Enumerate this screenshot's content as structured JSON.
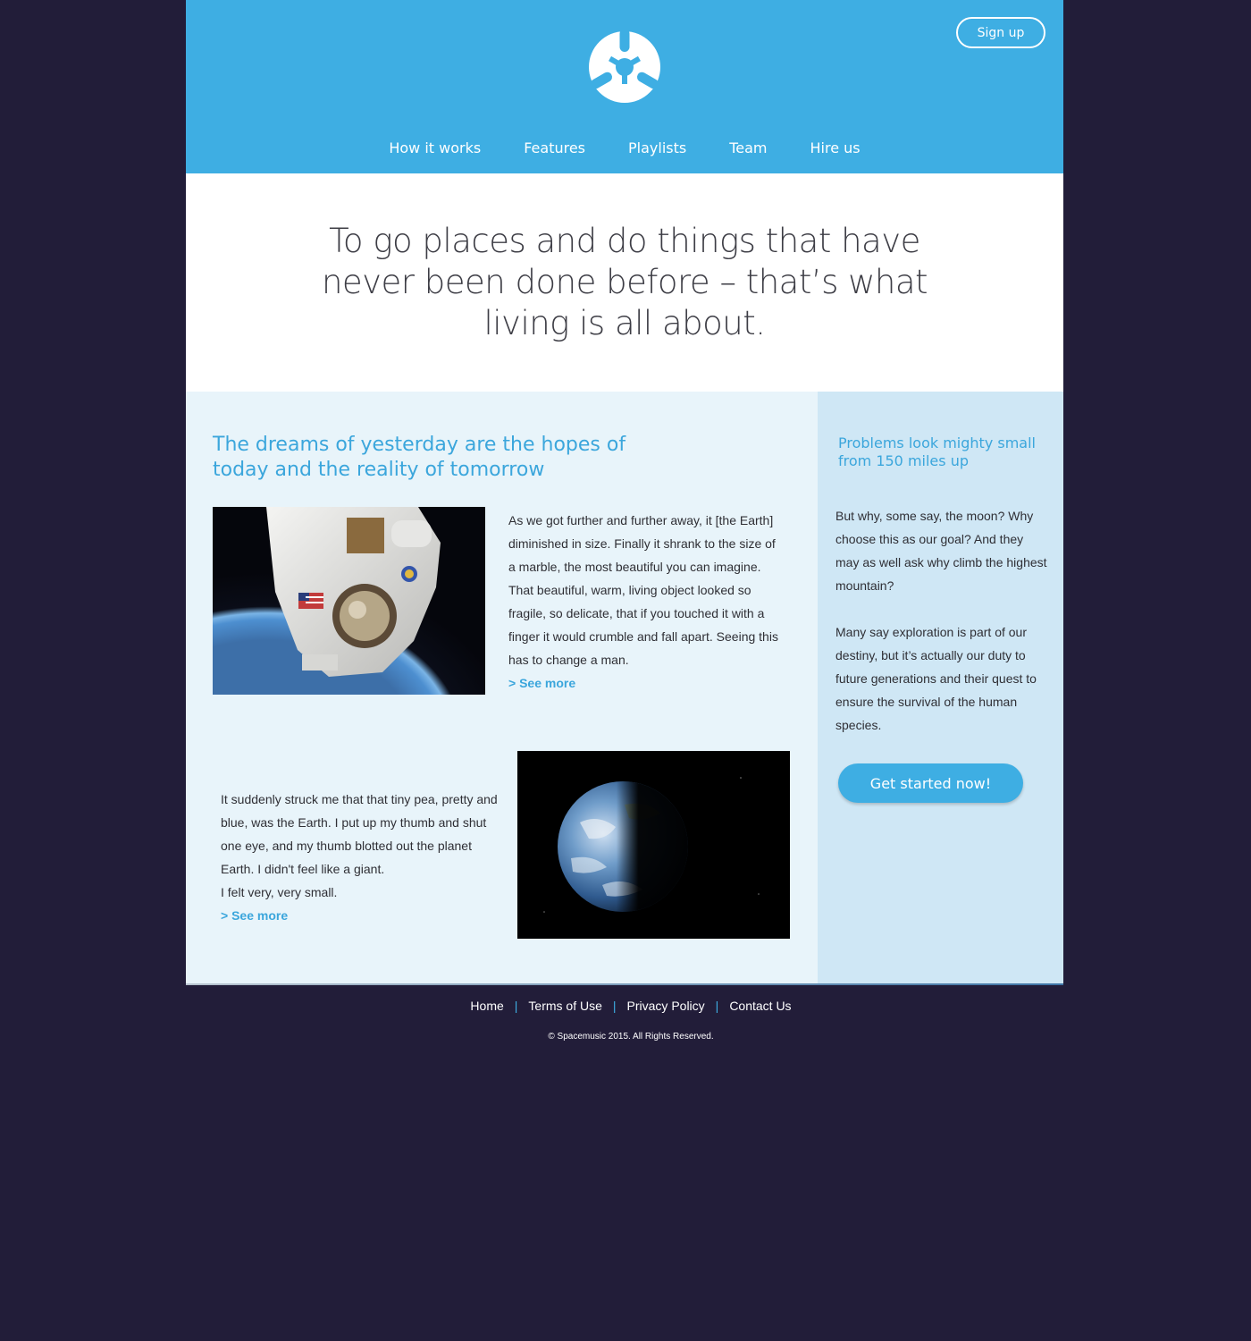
{
  "header": {
    "signup_label": "Sign up",
    "nav": [
      "How it works",
      "Features",
      "Playlists",
      "Team",
      "Hire us"
    ]
  },
  "quote": "To go places and do things that have never been done before – that’s what living is all about.",
  "main": {
    "heading": "The dreams of yesterday are the hopes of today and the reality of tomorrow",
    "article1": {
      "image_subject": "astronaut-photo",
      "text": "As we got further and further away, it [the Earth] diminished in size. Finally it shrank to the size of a marble, the most beautiful you can imagine. That beautiful, warm, living object looked so fragile, so delicate, that if you touched it with a finger it would crumble and fall apart. Seeing this has to change a man.",
      "see_more": "> See more"
    },
    "article2": {
      "image_subject": "earth-photo",
      "text": "It suddenly struck me that that tiny pea, pretty and blue, was the Earth. I put up my thumb and shut one eye, and my thumb blotted out the planet Earth. I didn't feel like a giant.",
      "text_line2": "I felt very, very small.",
      "see_more": "> See more"
    }
  },
  "side": {
    "heading": "Problems look mighty small from 150 miles up",
    "paragraph1": "But why, some say, the moon? Why choose this as our goal? And they may as well ask why climb the highest mountain?",
    "paragraph2": "Many say exploration is part of our destiny, but it’s actually our duty to future generations and their quest to ensure the survival of the human species.",
    "cta_label": "Get started now!"
  },
  "footer": {
    "links": [
      "Home",
      "Terms of Use",
      "Privacy Policy",
      "Contact Us"
    ],
    "separator": "|",
    "copyright": "© Spacemusic 2015. All Rights Reserved."
  },
  "colors": {
    "accent": "#3eaee3",
    "page_background": "#221d39",
    "main_background": "#e8f4fa",
    "side_background": "#cfe7f5"
  }
}
